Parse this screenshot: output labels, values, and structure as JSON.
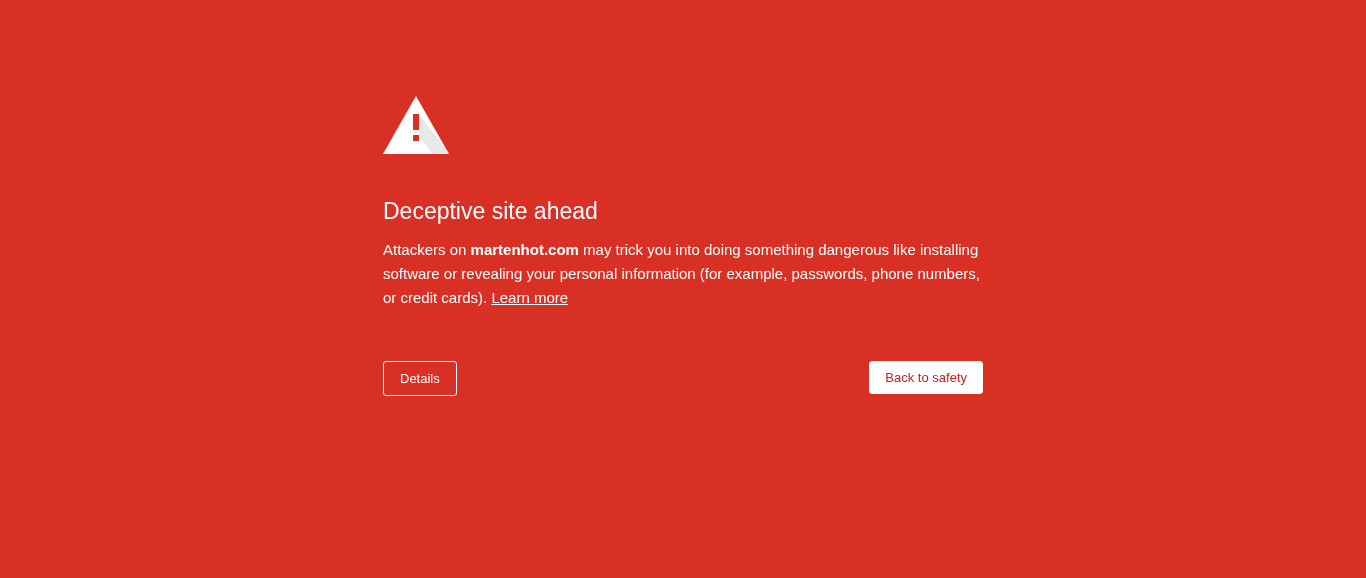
{
  "heading": "Deceptive site ahead",
  "message": "Attackers on **martenhot.com** may trick you into doing something dangerous like installing software or revealing your personal information (for example, passwords, phone numbers, or credit cards).",
  "learn_more_link": "Learn more",
  "buttons": [
    {
      "label": "Details",
      "kind": "secondary"
    },
    {
      "label": "Back to safety",
      "kind": "primary"
    }
  ]
}
